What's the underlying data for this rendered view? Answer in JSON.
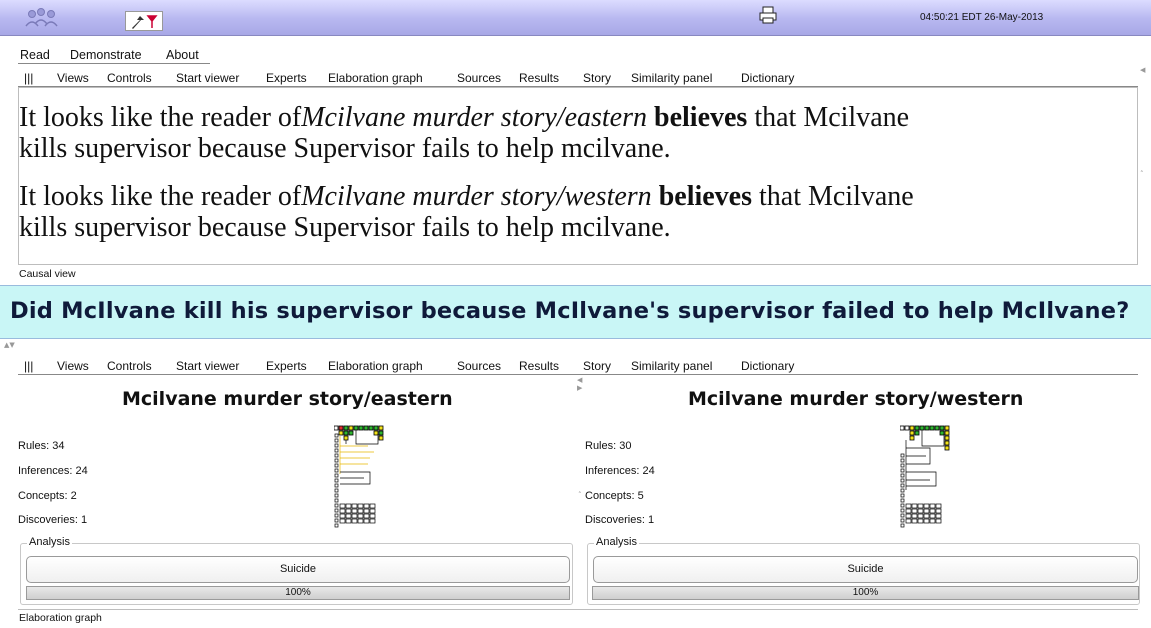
{
  "titlebar": {
    "clock": "04:50:21 EDT 26-May-2013",
    "logo_icon": "people-logo-icon",
    "tool_icons": [
      "pointer-icon",
      "arrow-icon"
    ],
    "print_icon": "printer-icon"
  },
  "menu": {
    "items": [
      "Read",
      "Demonstrate",
      "About"
    ]
  },
  "tabs": [
    "|||",
    "Views",
    "Controls",
    "Start viewer",
    "Experts",
    "Elaboration graph",
    "Sources",
    "Results",
    "Story",
    "Similarity panel",
    "Dictionary"
  ],
  "top_panel": {
    "lines": [
      {
        "prefix": "It looks like the reader of",
        "story": "Mcilvane murder story/eastern",
        "verb": "believes",
        "rest1": " that  Mcilvane",
        "rest2": "kills supervisor because Supervisor fails to help mcilvane."
      },
      {
        "prefix": "It looks like the reader of",
        "story": "Mcilvane murder story/western",
        "verb": "believes",
        "rest1": " that  Mcilvane",
        "rest2": "kills supervisor because Supervisor fails to help mcilvane."
      }
    ],
    "status": "Causal view"
  },
  "question": "Did McIlvane kill his supervisor because McIlvane's supervisor failed to help McIlvane?",
  "stories": [
    {
      "title": "Mcilvane murder story/eastern",
      "rules": "Rules: 34",
      "inferences": "Inferences: 24",
      "concepts": "Concepts: 2",
      "discoveries": "Discoveries: 1",
      "analysis_label": "Analysis",
      "button": "Suicide",
      "progress_text": "100%",
      "progress_value": 1.0
    },
    {
      "title": "Mcilvane murder story/western",
      "rules": "Rules: 30",
      "inferences": "Inferences: 24",
      "concepts": "Concepts: 5",
      "discoveries": "Discoveries: 1",
      "analysis_label": "Analysis",
      "button": "Suicide",
      "progress_text": "100%",
      "progress_value": 1.0
    }
  ],
  "bottom_status": "Elaboration graph",
  "colors": {
    "titlebar": "#b7b7f0",
    "question_bg": "#c9f6f6",
    "graph_green": "#2fb52f",
    "graph_yellow": "#f2e21a",
    "graph_red": "#e03030",
    "graph_line": "#e8b800"
  }
}
